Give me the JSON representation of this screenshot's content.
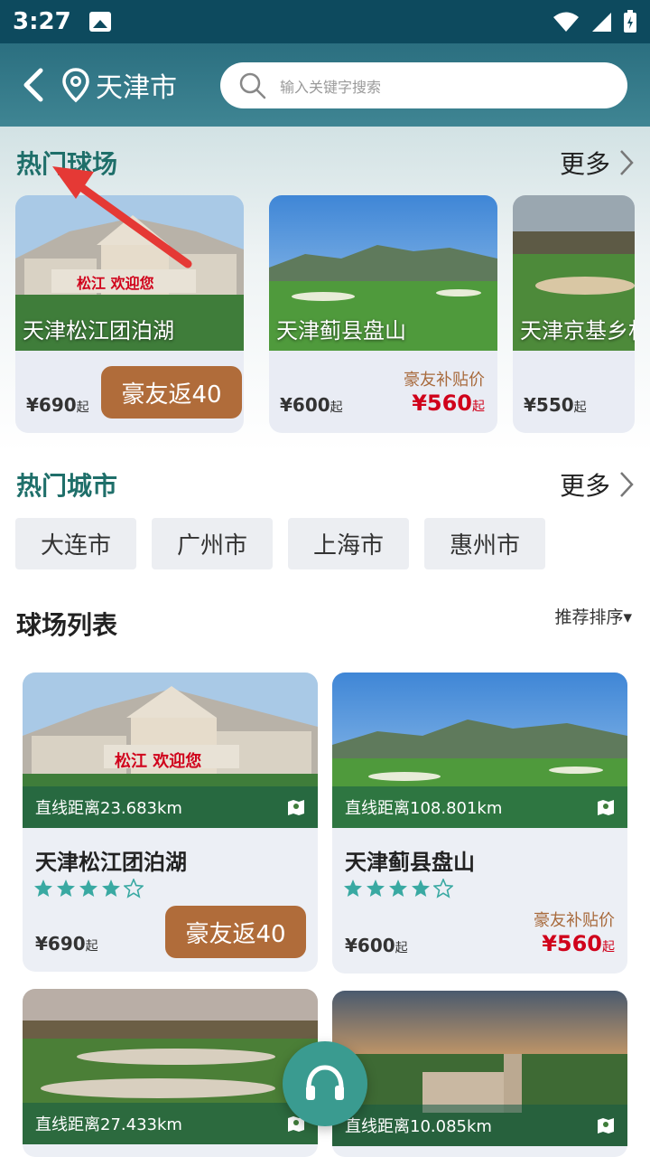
{
  "status_bar": {
    "time": "3:27"
  },
  "header": {
    "city": "天津市",
    "search_placeholder": "输入关键字搜索"
  },
  "hot_courses": {
    "title": "热门球场",
    "more": "更多",
    "items": [
      {
        "name": "天津松江团泊湖",
        "price": "¥690",
        "price_suffix": "起",
        "badge": "豪友返40",
        "image_sign": "松江 欢迎您"
      },
      {
        "name": "天津蓟县盘山",
        "price": "¥600",
        "price_suffix": "起",
        "subsidy_label": "豪友补贴价",
        "subsidy_price": "¥560",
        "subsidy_suffix": "起"
      },
      {
        "name": "天津京基乡村",
        "price": "¥550",
        "price_suffix": "起"
      }
    ]
  },
  "hot_cities": {
    "title": "热门城市",
    "more": "更多",
    "items": [
      "大连市",
      "广州市",
      "上海市",
      "惠州市"
    ]
  },
  "course_list": {
    "title": "球场列表",
    "sort": "推荐排序▾",
    "items": [
      {
        "distance": "直线距离23.683km",
        "name": "天津松江团泊湖",
        "rating": 4,
        "price": "¥690",
        "price_suffix": "起",
        "badge": "豪友返40",
        "image_sign": "松江 欢迎您"
      },
      {
        "distance": "直线距离108.801km",
        "name": "天津蓟县盘山",
        "rating": 4,
        "price": "¥600",
        "price_suffix": "起",
        "subsidy_label": "豪友补贴价",
        "subsidy_price": "¥560",
        "subsidy_suffix": "起"
      },
      {
        "distance": "直线距离27.433km"
      },
      {
        "distance": "直线距离10.085km"
      }
    ]
  },
  "colors": {
    "header": "#2b6f80",
    "teal_title": "#1f6f6a",
    "badge": "#b06c3a",
    "accent_red": "#d0021b",
    "star": "#39a9a2"
  }
}
